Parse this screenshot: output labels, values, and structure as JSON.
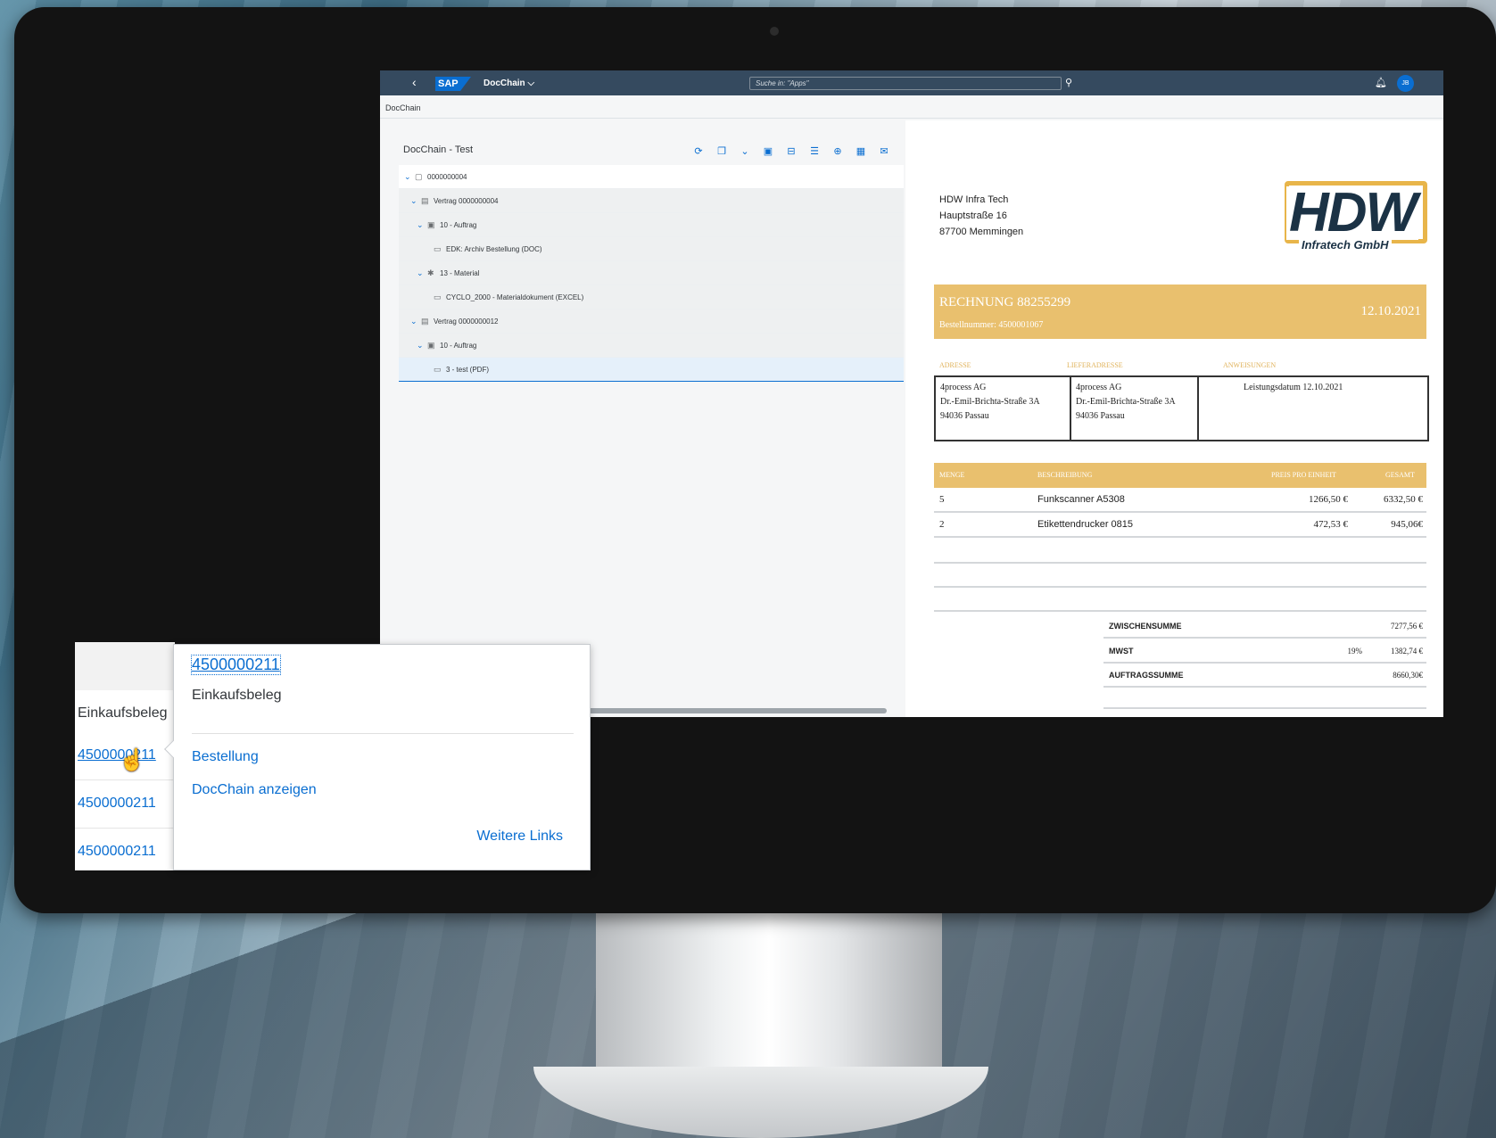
{
  "shell": {
    "back_icon": "back-icon",
    "logo": "SAP",
    "app_name": "DocChain ⌵",
    "search_placeholder": "Suche in: \"Apps\"",
    "avatar": "JB"
  },
  "breadcrumb": "DocChain",
  "panel": {
    "title": "DocChain - Test",
    "toolbar_icons": [
      "refresh-icon",
      "copy-icon",
      "expand-icon",
      "display-icon",
      "collapse-icon",
      "list-icon",
      "zoom-icon",
      "grid-icon",
      "mail-icon"
    ],
    "tree": [
      {
        "label": "0000000004",
        "level": 0,
        "chevron": "⌄"
      },
      {
        "label": "Vertrag 0000000004",
        "level": 1,
        "chevron": "⌄"
      },
      {
        "label": "10 - Auftrag",
        "level": 2,
        "chevron": "⌄"
      },
      {
        "label": "EDK: Archiv Bestellung (DOC)",
        "level": 3,
        "chevron": ""
      },
      {
        "label": "13 - Material",
        "level": 2,
        "chevron": "⌄"
      },
      {
        "label": "CYCLO_2000 - Materialdokument (EXCEL)",
        "level": 3,
        "chevron": ""
      },
      {
        "label": "Vertrag 0000000012",
        "level": 1,
        "chevron": "⌄"
      },
      {
        "label": "10 - Auftrag",
        "level": 2,
        "chevron": "⌄"
      },
      {
        "label": "3 - test (PDF)",
        "level": 3,
        "chevron": "",
        "selected": true
      }
    ]
  },
  "document": {
    "sender": [
      "HDW Infra Tech",
      "Hauptstraße 16",
      "87700 Memmingen"
    ],
    "logo_big": "HDW",
    "logo_small": "Infratech GmbH",
    "invoice_title": "RECHNUNG 88255299",
    "order_number": "Bestellnummer: 4500001067",
    "date": "12.10.2021",
    "labels": {
      "address": "ADRESSE",
      "delivery": "LIEFERADRESSE",
      "instructions": "ANWEISUNGEN"
    },
    "address": [
      "4process AG",
      "Dr.-Emil-Brichta-Straße 3A",
      "94036 Passau"
    ],
    "delivery": [
      "4process AG",
      "Dr.-Emil-Brichta-Straße 3A",
      "94036 Passau"
    ],
    "instructions": "Leistungsdatum 12.10.2021",
    "table_headers": {
      "qty": "MENGE",
      "desc": "BESCHREIBUNG",
      "unit": "PREIS PRO EINHEIT",
      "total": "GESAMT"
    },
    "rows": [
      {
        "qty": "5",
        "desc": "Funkscanner A5308",
        "unit": "1266,50 €",
        "total": "6332,50 €"
      },
      {
        "qty": "2",
        "desc": "Etikettendrucker 0815",
        "unit": "472,53 €",
        "total": "945,06€"
      }
    ],
    "subtotal_label": "ZWISCHENSUMME",
    "subtotal": "7277,56 €",
    "tax_label": "MWST",
    "tax_rate": "19%",
    "tax": "1382,74 €",
    "total_label": "AUFTRAGSSUMME",
    "total": "8660,30€"
  },
  "left_table": {
    "column": "Einkaufsbeleg",
    "cells": [
      "4500000211",
      "4500000211",
      "4500000211"
    ]
  },
  "popover": {
    "title": "4500000211",
    "subtitle": "Einkaufsbeleg",
    "links": [
      "Bestellung",
      "DocChain anzeigen"
    ],
    "more": "Weitere Links"
  }
}
